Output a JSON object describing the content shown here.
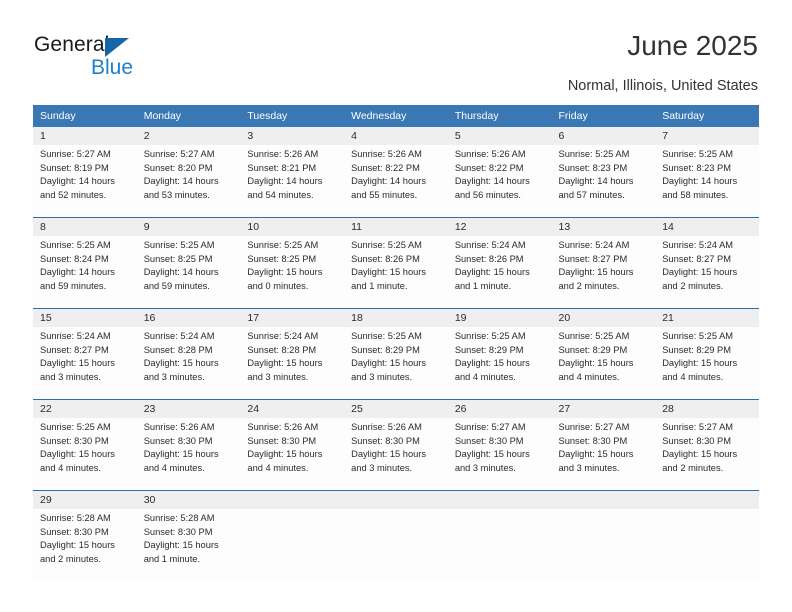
{
  "brand": {
    "name_part1": "General",
    "name_part2": "Blue",
    "accent_color": "#2081c9",
    "triangle_color": "#1565a8"
  },
  "header": {
    "title": "June 2025",
    "location": "Normal, Illinois, United States"
  },
  "calendar": {
    "header_bg": "#3a78b5",
    "daynum_bg": "#efefef",
    "separator_color": "#2f6daf",
    "weekday_headers": [
      "Sunday",
      "Monday",
      "Tuesday",
      "Wednesday",
      "Thursday",
      "Friday",
      "Saturday"
    ],
    "weeks": [
      {
        "days": [
          {
            "num": "1",
            "sunrise": "Sunrise: 5:27 AM",
            "sunset": "Sunset: 8:19 PM",
            "daylight": "Daylight: 14 hours and 52 minutes."
          },
          {
            "num": "2",
            "sunrise": "Sunrise: 5:27 AM",
            "sunset": "Sunset: 8:20 PM",
            "daylight": "Daylight: 14 hours and 53 minutes."
          },
          {
            "num": "3",
            "sunrise": "Sunrise: 5:26 AM",
            "sunset": "Sunset: 8:21 PM",
            "daylight": "Daylight: 14 hours and 54 minutes."
          },
          {
            "num": "4",
            "sunrise": "Sunrise: 5:26 AM",
            "sunset": "Sunset: 8:22 PM",
            "daylight": "Daylight: 14 hours and 55 minutes."
          },
          {
            "num": "5",
            "sunrise": "Sunrise: 5:26 AM",
            "sunset": "Sunset: 8:22 PM",
            "daylight": "Daylight: 14 hours and 56 minutes."
          },
          {
            "num": "6",
            "sunrise": "Sunrise: 5:25 AM",
            "sunset": "Sunset: 8:23 PM",
            "daylight": "Daylight: 14 hours and 57 minutes."
          },
          {
            "num": "7",
            "sunrise": "Sunrise: 5:25 AM",
            "sunset": "Sunset: 8:23 PM",
            "daylight": "Daylight: 14 hours and 58 minutes."
          }
        ]
      },
      {
        "days": [
          {
            "num": "8",
            "sunrise": "Sunrise: 5:25 AM",
            "sunset": "Sunset: 8:24 PM",
            "daylight": "Daylight: 14 hours and 59 minutes."
          },
          {
            "num": "9",
            "sunrise": "Sunrise: 5:25 AM",
            "sunset": "Sunset: 8:25 PM",
            "daylight": "Daylight: 14 hours and 59 minutes."
          },
          {
            "num": "10",
            "sunrise": "Sunrise: 5:25 AM",
            "sunset": "Sunset: 8:25 PM",
            "daylight": "Daylight: 15 hours and 0 minutes."
          },
          {
            "num": "11",
            "sunrise": "Sunrise: 5:25 AM",
            "sunset": "Sunset: 8:26 PM",
            "daylight": "Daylight: 15 hours and 1 minute."
          },
          {
            "num": "12",
            "sunrise": "Sunrise: 5:24 AM",
            "sunset": "Sunset: 8:26 PM",
            "daylight": "Daylight: 15 hours and 1 minute."
          },
          {
            "num": "13",
            "sunrise": "Sunrise: 5:24 AM",
            "sunset": "Sunset: 8:27 PM",
            "daylight": "Daylight: 15 hours and 2 minutes."
          },
          {
            "num": "14",
            "sunrise": "Sunrise: 5:24 AM",
            "sunset": "Sunset: 8:27 PM",
            "daylight": "Daylight: 15 hours and 2 minutes."
          }
        ]
      },
      {
        "days": [
          {
            "num": "15",
            "sunrise": "Sunrise: 5:24 AM",
            "sunset": "Sunset: 8:27 PM",
            "daylight": "Daylight: 15 hours and 3 minutes."
          },
          {
            "num": "16",
            "sunrise": "Sunrise: 5:24 AM",
            "sunset": "Sunset: 8:28 PM",
            "daylight": "Daylight: 15 hours and 3 minutes."
          },
          {
            "num": "17",
            "sunrise": "Sunrise: 5:24 AM",
            "sunset": "Sunset: 8:28 PM",
            "daylight": "Daylight: 15 hours and 3 minutes."
          },
          {
            "num": "18",
            "sunrise": "Sunrise: 5:25 AM",
            "sunset": "Sunset: 8:29 PM",
            "daylight": "Daylight: 15 hours and 3 minutes."
          },
          {
            "num": "19",
            "sunrise": "Sunrise: 5:25 AM",
            "sunset": "Sunset: 8:29 PM",
            "daylight": "Daylight: 15 hours and 4 minutes."
          },
          {
            "num": "20",
            "sunrise": "Sunrise: 5:25 AM",
            "sunset": "Sunset: 8:29 PM",
            "daylight": "Daylight: 15 hours and 4 minutes."
          },
          {
            "num": "21",
            "sunrise": "Sunrise: 5:25 AM",
            "sunset": "Sunset: 8:29 PM",
            "daylight": "Daylight: 15 hours and 4 minutes."
          }
        ]
      },
      {
        "days": [
          {
            "num": "22",
            "sunrise": "Sunrise: 5:25 AM",
            "sunset": "Sunset: 8:30 PM",
            "daylight": "Daylight: 15 hours and 4 minutes."
          },
          {
            "num": "23",
            "sunrise": "Sunrise: 5:26 AM",
            "sunset": "Sunset: 8:30 PM",
            "daylight": "Daylight: 15 hours and 4 minutes."
          },
          {
            "num": "24",
            "sunrise": "Sunrise: 5:26 AM",
            "sunset": "Sunset: 8:30 PM",
            "daylight": "Daylight: 15 hours and 4 minutes."
          },
          {
            "num": "25",
            "sunrise": "Sunrise: 5:26 AM",
            "sunset": "Sunset: 8:30 PM",
            "daylight": "Daylight: 15 hours and 3 minutes."
          },
          {
            "num": "26",
            "sunrise": "Sunrise: 5:27 AM",
            "sunset": "Sunset: 8:30 PM",
            "daylight": "Daylight: 15 hours and 3 minutes."
          },
          {
            "num": "27",
            "sunrise": "Sunrise: 5:27 AM",
            "sunset": "Sunset: 8:30 PM",
            "daylight": "Daylight: 15 hours and 3 minutes."
          },
          {
            "num": "28",
            "sunrise": "Sunrise: 5:27 AM",
            "sunset": "Sunset: 8:30 PM",
            "daylight": "Daylight: 15 hours and 2 minutes."
          }
        ]
      },
      {
        "days": [
          {
            "num": "29",
            "sunrise": "Sunrise: 5:28 AM",
            "sunset": "Sunset: 8:30 PM",
            "daylight": "Daylight: 15 hours and 2 minutes."
          },
          {
            "num": "30",
            "sunrise": "Sunrise: 5:28 AM",
            "sunset": "Sunset: 8:30 PM",
            "daylight": "Daylight: 15 hours and 1 minute."
          },
          {
            "num": "",
            "sunrise": "",
            "sunset": "",
            "daylight": ""
          },
          {
            "num": "",
            "sunrise": "",
            "sunset": "",
            "daylight": ""
          },
          {
            "num": "",
            "sunrise": "",
            "sunset": "",
            "daylight": ""
          },
          {
            "num": "",
            "sunrise": "",
            "sunset": "",
            "daylight": ""
          },
          {
            "num": "",
            "sunrise": "",
            "sunset": "",
            "daylight": ""
          }
        ]
      }
    ]
  }
}
